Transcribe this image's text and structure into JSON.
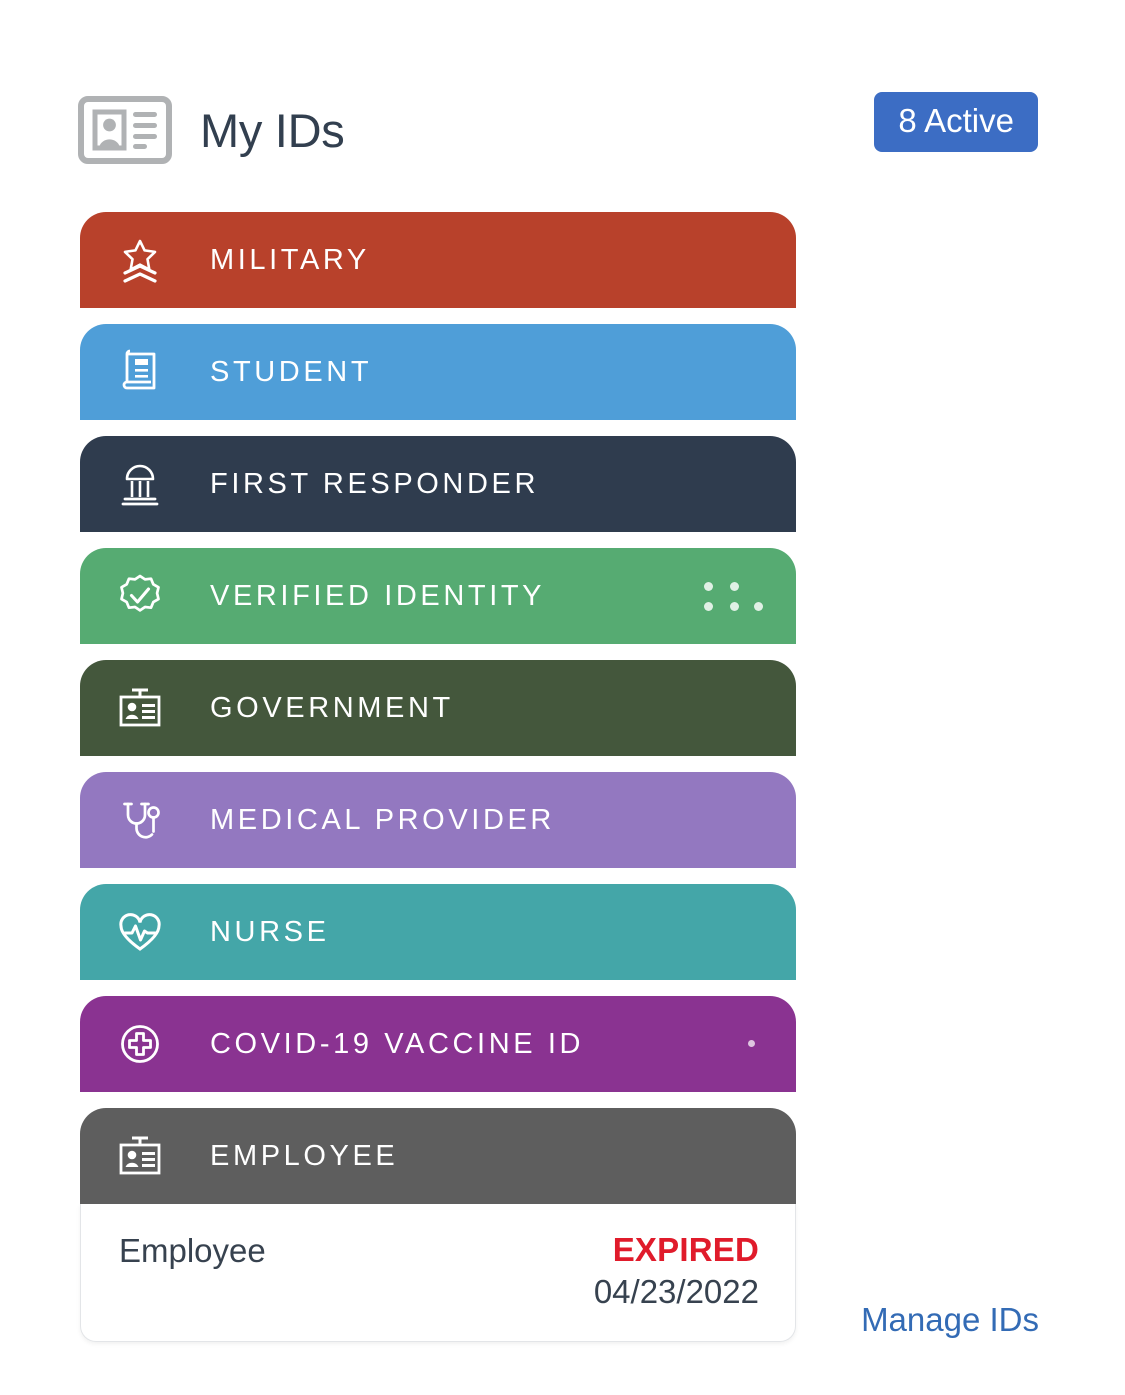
{
  "header": {
    "title": "My IDs",
    "icon": "id-card-icon",
    "badge": {
      "label": "8 Active",
      "count": 8,
      "color": "#3c6dc4"
    }
  },
  "ids": [
    {
      "label": "MILITARY",
      "icon": "military-rank-star-icon",
      "color": "#b8412b",
      "indicator": "none"
    },
    {
      "label": "STUDENT",
      "icon": "book-icon",
      "color": "#4f9ed8",
      "indicator": "none"
    },
    {
      "label": "FIRST RESPONDER",
      "icon": "institution-building-icon",
      "color": "#2f3c4e",
      "indicator": "none"
    },
    {
      "label": "VERIFIED IDENTITY",
      "icon": "verified-badge-check-icon",
      "color": "#56ab72",
      "indicator": "dots-five"
    },
    {
      "label": "GOVERNMENT",
      "icon": "id-badge-icon",
      "color": "#44573c",
      "indicator": "none"
    },
    {
      "label": "MEDICAL PROVIDER",
      "icon": "stethoscope-icon",
      "color": "#9378c0",
      "indicator": "none"
    },
    {
      "label": "NURSE",
      "icon": "heart-pulse-icon",
      "color": "#44a6a8",
      "indicator": "none"
    },
    {
      "label": "COVID-19 VACCINE ID",
      "icon": "medical-cross-circle-icon",
      "color": "#8a3391",
      "indicator": "dot-single"
    },
    {
      "label": "EMPLOYEE",
      "icon": "id-badge-icon",
      "color": "#5e5e5e",
      "indicator": "none"
    }
  ],
  "employee_detail": {
    "name": "Employee",
    "status": "EXPIRED",
    "status_color": "#e01b2b",
    "date": "04/23/2022"
  },
  "footer": {
    "manage_link": "Manage IDs",
    "link_color": "#336bb5"
  }
}
